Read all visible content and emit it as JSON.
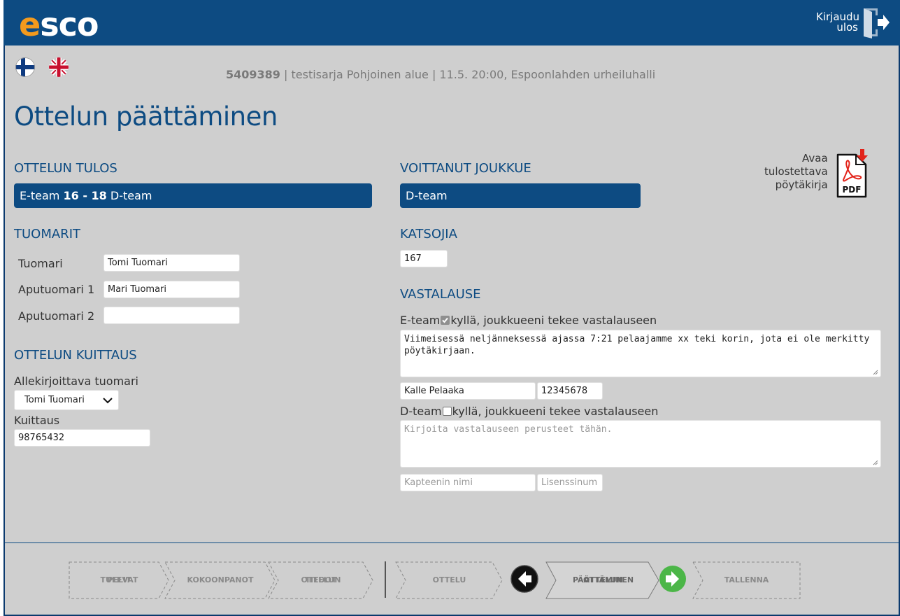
{
  "header": {
    "logo_e": "e",
    "logo_rest": "sco",
    "logout_label": "Kirjaudu ulos"
  },
  "flags": [
    {
      "name": "finnish-flag"
    },
    {
      "name": "english-flag"
    }
  ],
  "match": {
    "id": "5409389",
    "details": " | testisarja Pohjoinen alue | 11.5. 20:00, Espoonlahden urheiluhalli"
  },
  "page_title": "Ottelun päättäminen",
  "result": {
    "title": "OTTELUN TULOS",
    "home": "E-team ",
    "score": "16 - 18",
    "away": " D-team"
  },
  "winner": {
    "title": "VOITTANUT JOUKKUE",
    "team": "D-team"
  },
  "pdf": {
    "label_line1": "Avaa",
    "label_line2": "tulostettava",
    "label_line3": "pöytäkirja",
    "badge": "PDF"
  },
  "referees": {
    "title": "TUOMARIT",
    "rows": [
      {
        "label": "Tuomari",
        "value": "Tomi Tuomari"
      },
      {
        "label": "Aputuomari 1",
        "value": "Mari Tuomari"
      },
      {
        "label": "Aputuomari 2",
        "value": ""
      }
    ]
  },
  "spectators": {
    "title": "KATSOJIA",
    "value": "167"
  },
  "confirmation": {
    "title": "OTTELUN KUITTAUS",
    "signing_label": "Allekirjoittava tuomari",
    "signing_value": "Tomi Tuomari",
    "code_label": "Kuittaus",
    "code_value": "98765432"
  },
  "protest": {
    "title": "VASTALAUSE",
    "teams": [
      {
        "team": "E-team",
        "checked": true,
        "checkbox_label": "kyllä, joukkueeni tekee vastalauseen",
        "text": "Viimeisessä neljänneksessä ajassa 7:21 pelaajamme xx teki korin, jota ei ole merkitty pöytäkirjaan.",
        "text_placeholder": "",
        "captain": "Kalle Pelaaka",
        "captain_placeholder": "",
        "license": "12345678",
        "license_placeholder": ""
      },
      {
        "team": "D-team",
        "checked": false,
        "checkbox_label": "kyllä, joukkueeni tekee vastalauseen",
        "text": "",
        "text_placeholder": "Kirjoita vastalauseen perusteet tähän.",
        "captain": "",
        "captain_placeholder": "Kapteenin nimi",
        "license": "",
        "license_placeholder": "Lisenssinum"
      }
    ]
  },
  "steps": [
    {
      "label_1": "TULEVAT",
      "label_2": "PELIT"
    },
    {
      "label_1": "KOKOONPANOT",
      "label_2": ""
    },
    {
      "label_1": "OTTELUN",
      "label_2": "TIEDOT"
    },
    {
      "label_1": "OTTELU",
      "label_2": ""
    },
    {
      "label_1": "OTTELUN",
      "label_2": "PÄÄTTÄMINEN"
    },
    {
      "label_1": "TALLENNA",
      "label_2": ""
    }
  ],
  "colors": {
    "brand": "#0d4b82",
    "accent": "#f39a1d",
    "next": "#4cb648"
  }
}
